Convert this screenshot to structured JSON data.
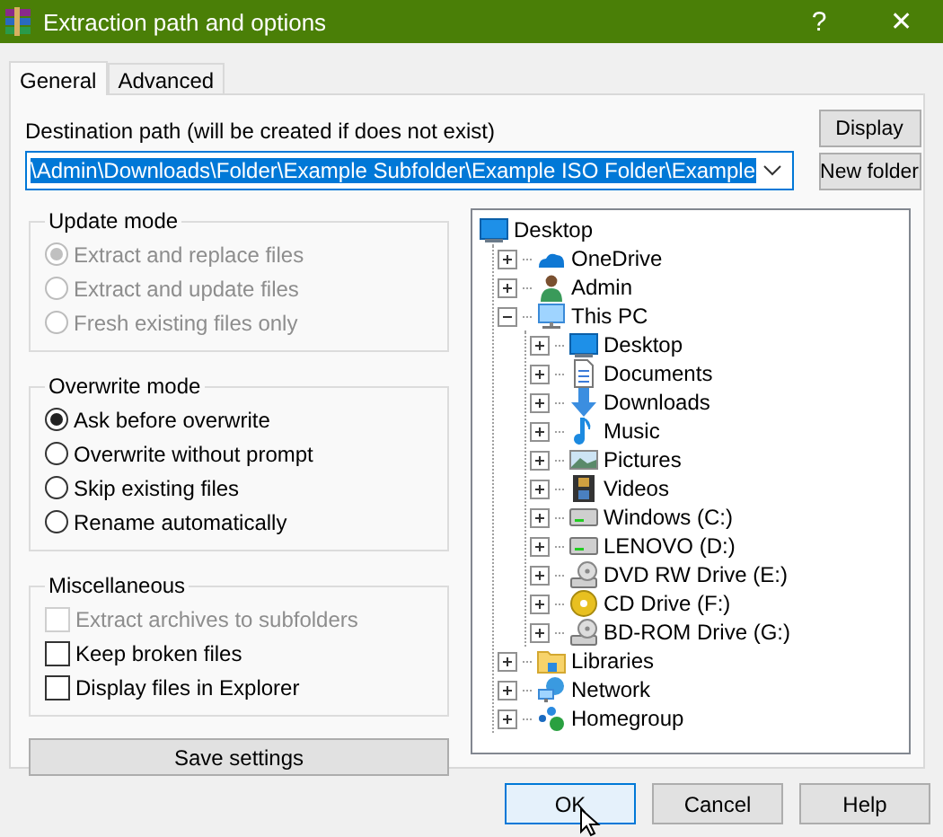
{
  "window": {
    "title": "Extraction path and options",
    "controls": [
      "?",
      "✕"
    ]
  },
  "tabs": [
    {
      "label": "General",
      "selected": true
    },
    {
      "label": "Advanced",
      "selected": false
    }
  ],
  "destination": {
    "label": "Destination path (will be created if does not exist)",
    "value": "\\Admin\\Downloads\\Folder\\Example Subfolder\\Example ISO Folder\\Example",
    "value_selected": true
  },
  "side_buttons": [
    "Display",
    "New folder"
  ],
  "groups": [
    {
      "title": "Update mode",
      "kind": "radio",
      "options": [
        {
          "label": "Extract and replace files",
          "selected": true,
          "disabled": true
        },
        {
          "label": "Extract and update files",
          "selected": false,
          "disabled": true
        },
        {
          "label": "Fresh existing files only",
          "selected": false,
          "disabled": true
        }
      ]
    },
    {
      "title": "Overwrite mode",
      "kind": "radio",
      "options": [
        {
          "label": "Ask before overwrite",
          "selected": true,
          "disabled": false
        },
        {
          "label": "Overwrite without prompt",
          "selected": false,
          "disabled": false
        },
        {
          "label": "Skip existing files",
          "selected": false,
          "disabled": false
        },
        {
          "label": "Rename automatically",
          "selected": false,
          "disabled": false
        }
      ]
    },
    {
      "title": "Miscellaneous",
      "kind": "checkbox",
      "options": [
        {
          "label": "Extract archives to subfolders",
          "checked": false,
          "disabled": true
        },
        {
          "label": "Keep broken files",
          "checked": false,
          "disabled": false
        },
        {
          "label": "Display files in Explorer",
          "checked": false,
          "disabled": false
        }
      ]
    }
  ],
  "save_button": "Save settings",
  "tree": {
    "label": "Desktop",
    "kind": "desktop",
    "children": [
      {
        "label": "OneDrive",
        "kind": "cloud",
        "expanded": false
      },
      {
        "label": "Admin",
        "kind": "user",
        "expanded": false
      },
      {
        "label": "This PC",
        "kind": "pc",
        "expanded": true,
        "children": [
          {
            "label": "Desktop",
            "kind": "desktop",
            "expanded": false
          },
          {
            "label": "Documents",
            "kind": "document",
            "expanded": false
          },
          {
            "label": "Downloads",
            "kind": "download",
            "expanded": false
          },
          {
            "label": "Music",
            "kind": "music",
            "expanded": false
          },
          {
            "label": "Pictures",
            "kind": "pictures",
            "expanded": false
          },
          {
            "label": "Videos",
            "kind": "film",
            "expanded": false
          },
          {
            "label": "Windows (C:)",
            "kind": "drive",
            "expanded": false
          },
          {
            "label": "LENOVO (D:)",
            "kind": "drive",
            "expanded": false
          },
          {
            "label": "DVD RW Drive (E:)",
            "kind": "optical",
            "expanded": false
          },
          {
            "label": "CD Drive (F:)",
            "kind": "cd",
            "expanded": false
          },
          {
            "label": "BD-ROM Drive (G:)",
            "kind": "optical",
            "expanded": false
          }
        ]
      },
      {
        "label": "Libraries",
        "kind": "folder",
        "expanded": false
      },
      {
        "label": "Network",
        "kind": "network",
        "expanded": false
      },
      {
        "label": "Homegroup",
        "kind": "homegroup",
        "expanded": false
      }
    ]
  },
  "footer_buttons": [
    {
      "label": "OK",
      "default": true
    },
    {
      "label": "Cancel",
      "default": false
    },
    {
      "label": "Help",
      "default": false
    }
  ]
}
